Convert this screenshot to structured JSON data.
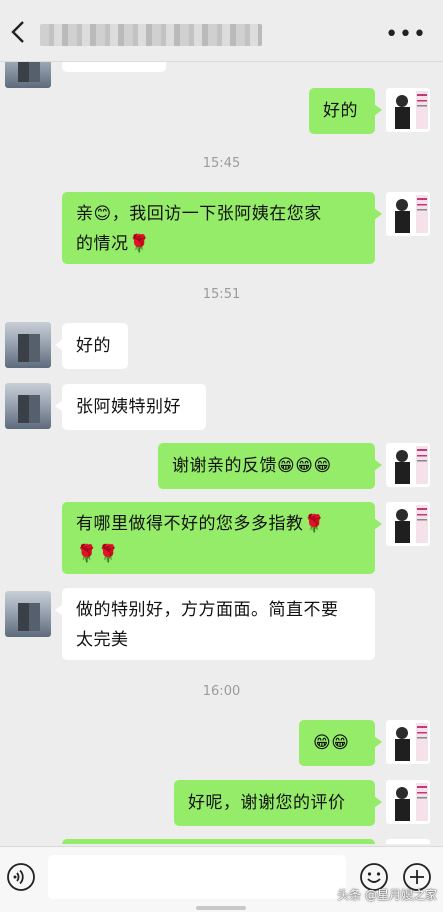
{
  "header": {
    "title": "",
    "more_label": "•••"
  },
  "messages": [
    {
      "side": "out",
      "text": "好的"
    },
    {
      "time": "15:45"
    },
    {
      "side": "out",
      "text_line1": "亲😊，我回访一下张阿姨在您家",
      "text_line2": "的情况🌹"
    },
    {
      "time": "15:51"
    },
    {
      "side": "in",
      "text": "好的"
    },
    {
      "side": "in",
      "text": "张阿姨特别好"
    },
    {
      "side": "out",
      "text": "谢谢亲的反馈😁😁😁"
    },
    {
      "side": "out",
      "text_line1": "有哪里做得不好的您多多指教🌹",
      "text_line2": "🌹🌹"
    },
    {
      "side": "in",
      "text_line1": "做的特别好，方方面面。简直不要",
      "text_line2": "太完美"
    },
    {
      "time": "16:00"
    },
    {
      "side": "out",
      "text": "😁😁"
    },
    {
      "side": "out",
      "text": "好呢，谢谢您的评价"
    }
  ],
  "watermark": "头条 @星月嫂之家",
  "colors": {
    "bg": "#ededed",
    "out_bubble": "#95ec69",
    "in_bubble": "#ffffff"
  }
}
